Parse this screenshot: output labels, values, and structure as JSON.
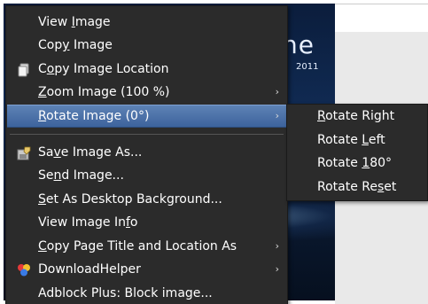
{
  "background": {
    "brand_text": "ne",
    "brand_year": "2011"
  },
  "context_menu": {
    "items": [
      {
        "label": "View Image",
        "mnemonic_index": 5
      },
      {
        "label": "Copy Image",
        "mnemonic_index": 3
      },
      {
        "label": "Copy Image Location",
        "mnemonic_index": 1,
        "icon": "copy-location-icon"
      },
      {
        "label": "Zoom Image (100 %)",
        "mnemonic_index": 0,
        "has_submenu": true
      },
      {
        "label": "Rotate Image (0°)",
        "mnemonic_index": 0,
        "has_submenu": true,
        "highlighted": true
      },
      {
        "label": "Save Image As...",
        "mnemonic_index": 2,
        "icon": "save-image-icon"
      },
      {
        "label": "Send Image...",
        "mnemonic_index": 2
      },
      {
        "label": "Set As Desktop Background...",
        "mnemonic_index": 0
      },
      {
        "label": "View Image Info",
        "mnemonic_index": 13
      },
      {
        "label": "Copy Page Title and Location As",
        "mnemonic_index": 0,
        "has_submenu": true
      },
      {
        "label": "DownloadHelper",
        "mnemonic_index": -1,
        "has_submenu": true,
        "icon": "downloadhelper-icon"
      },
      {
        "label": "Adblock Plus: Block image...",
        "mnemonic_index": -1
      }
    ],
    "submenu_arrow": "›"
  },
  "rotate_submenu": {
    "items": [
      {
        "label": "Rotate Right",
        "mnemonic_index": 0
      },
      {
        "label": "Rotate Left",
        "mnemonic_index": 7
      },
      {
        "label": "Rotate 180°",
        "mnemonic_index": 7
      },
      {
        "label": "Rotate Reset",
        "mnemonic_index": 9
      }
    ]
  },
  "colors": {
    "menu_background": "#2b2b2b",
    "highlight": "#4a70a8",
    "text": "#ffffff"
  }
}
